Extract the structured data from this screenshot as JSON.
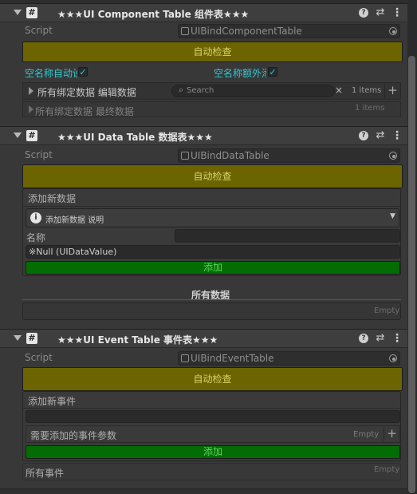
{
  "components": [
    {
      "title": "★★★UI Component Table 组件表★★★",
      "script_label": "Script",
      "script_value": "UIBindComponentTable",
      "auto_check": "自动检查",
      "toggle_left": "空名称自动设",
      "toggle_right": "空名称额外添",
      "edit_data": "所有绑定数据 编辑数据",
      "search_placeholder": "Search",
      "clear_glyph": "×",
      "items_count": "1 items",
      "final_data": "所有绑定数据 最终数据",
      "final_count": "1 items"
    },
    {
      "title": "★★★UI Data Table 数据表★★★",
      "script_label": "Script",
      "script_value": "UIBindDataTable",
      "auto_check": "自动检查",
      "add_new": "添加新数据",
      "info_dropdown": "添加新数据 说明",
      "name_label": "名称",
      "null_value": "※Null (UIDataValue)",
      "add_button": "添加",
      "all_data": "所有数据",
      "empty": "Empty"
    },
    {
      "title": "★★★UI Event Table 事件表★★★",
      "script_label": "Script",
      "script_value": "UIBindEventTable",
      "auto_check": "自动检查",
      "add_new": "添加新事件",
      "params_label": "需要添加的事件参数",
      "params_empty": "Empty",
      "add_button": "添加",
      "all_events": "所有事件",
      "empty": "Empty"
    }
  ],
  "header_icons": {
    "help": "?",
    "preset": "⇄",
    "menu": "⋮",
    "badge": "#"
  },
  "colors": {
    "olive_button": "#6c6400",
    "green_button": "#046c04",
    "cyan_text": "#2ccbd2"
  }
}
